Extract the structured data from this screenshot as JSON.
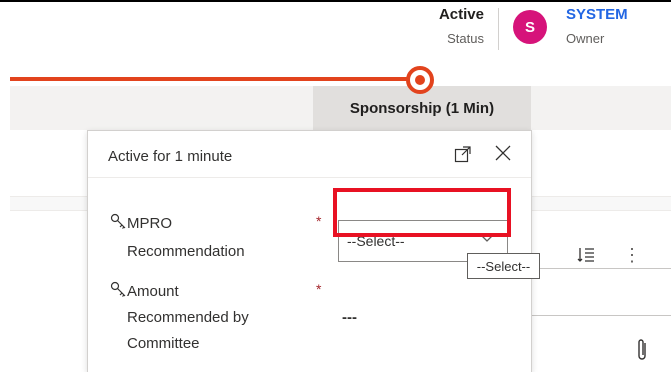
{
  "header": {
    "status": {
      "value": "Active",
      "label": "Status"
    },
    "owner": {
      "avatar_initial": "S",
      "value": "SYSTEM",
      "label": "Owner"
    }
  },
  "process": {
    "active_stage_label": "Sponsorship  (1 Min)"
  },
  "flyout": {
    "title": "Active for 1 minute",
    "fields": [
      {
        "label_lines": [
          "MPRO",
          "Recommendation"
        ],
        "required": "*",
        "value": "--Select--"
      },
      {
        "label_lines": [
          "Amount",
          "Recommended by",
          "Committee"
        ],
        "required": "*",
        "value": "---"
      }
    ]
  },
  "tooltip": {
    "text": "--Select--"
  },
  "colors": {
    "accent": "#e2431d",
    "avatar": "#d6137a",
    "owner_link": "#2266e3",
    "highlight": "#e81123"
  }
}
